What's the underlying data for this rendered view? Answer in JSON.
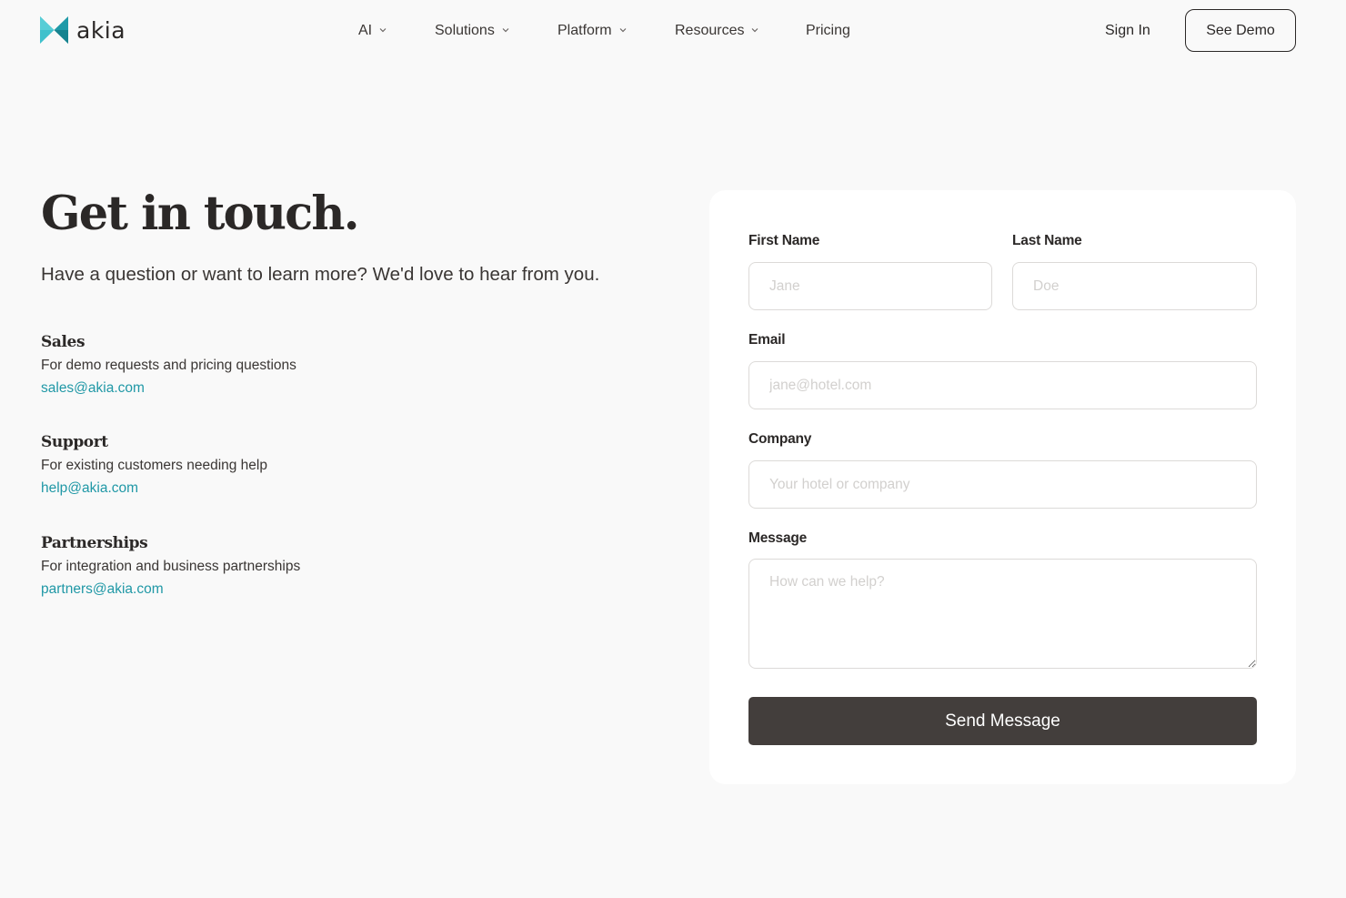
{
  "brand": {
    "name": "akia",
    "accent_color": "#2bb3bf",
    "logo_icon": "bowtie-logo-icon"
  },
  "nav": {
    "items": [
      {
        "label": "AI",
        "has_dropdown": true
      },
      {
        "label": "Solutions",
        "has_dropdown": true
      },
      {
        "label": "Platform",
        "has_dropdown": true
      },
      {
        "label": "Resources",
        "has_dropdown": true
      },
      {
        "label": "Pricing",
        "has_dropdown": false
      }
    ],
    "sign_in": "Sign In",
    "see_demo": "See Demo"
  },
  "hero": {
    "title": "Get in touch.",
    "subtitle": "Have a question or want to learn more? We'd love to hear from you."
  },
  "contacts": [
    {
      "heading": "Sales",
      "description": "For demo requests and pricing questions",
      "email": "sales@akia.com"
    },
    {
      "heading": "Support",
      "description": "For existing customers needing help",
      "email": "help@akia.com"
    },
    {
      "heading": "Partnerships",
      "description": "For integration and business partnerships",
      "email": "partners@akia.com"
    }
  ],
  "form": {
    "first_name": {
      "label": "First Name",
      "placeholder": "Jane",
      "value": ""
    },
    "last_name": {
      "label": "Last Name",
      "placeholder": "Doe",
      "value": ""
    },
    "email": {
      "label": "Email",
      "placeholder": "jane@hotel.com",
      "value": ""
    },
    "company": {
      "label": "Company",
      "placeholder": "Your hotel or company",
      "value": ""
    },
    "message": {
      "label": "Message",
      "placeholder": "How can we help?",
      "value": ""
    },
    "submit_label": "Send Message",
    "submit_color": "#433e3c",
    "link_color": "#2098a6"
  }
}
